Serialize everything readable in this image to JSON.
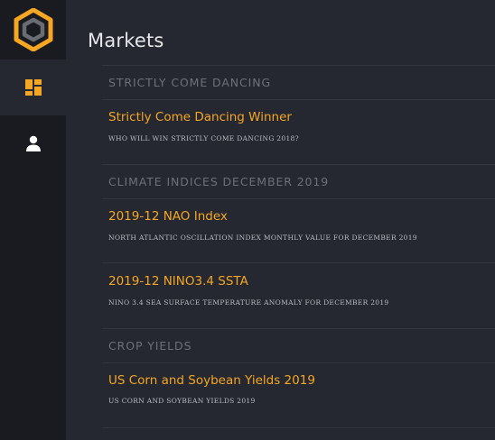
{
  "page": {
    "title": "Markets"
  },
  "sidebar": {
    "logo": "hexagon-logo",
    "items": [
      {
        "name": "markets",
        "icon": "dashboard-icon",
        "active": true
      },
      {
        "name": "account",
        "icon": "user-icon",
        "active": false
      }
    ]
  },
  "colors": {
    "accent": "#f5a623",
    "background": "#252830",
    "sidebar": "#191b20",
    "category_text": "#6e7078",
    "description_text": "#b9bbc2"
  },
  "categories": [
    {
      "title": "STRICTLY COME DANCING",
      "markets": [
        {
          "title": "Strictly Come Dancing Winner",
          "description": "WHO WILL WIN STRICTLY COME DANCING 2018?"
        }
      ]
    },
    {
      "title": "CLIMATE INDICES DECEMBER 2019",
      "markets": [
        {
          "title": "2019-12 NAO Index",
          "description": "NORTH ATLANTIC OSCILLATION INDEX MONTHLY VALUE FOR DECEMBER 2019"
        },
        {
          "title": "2019-12 NINO3.4 SSTA",
          "description": "NINO 3.4 SEA SURFACE TEMPERATURE ANOMALY FOR DECEMBER 2019"
        }
      ]
    },
    {
      "title": "CROP YIELDS",
      "markets": [
        {
          "title": "US Corn and Soybean Yields 2019",
          "description": "US CORN AND SOYBEAN YIELDS 2019"
        }
      ]
    }
  ]
}
